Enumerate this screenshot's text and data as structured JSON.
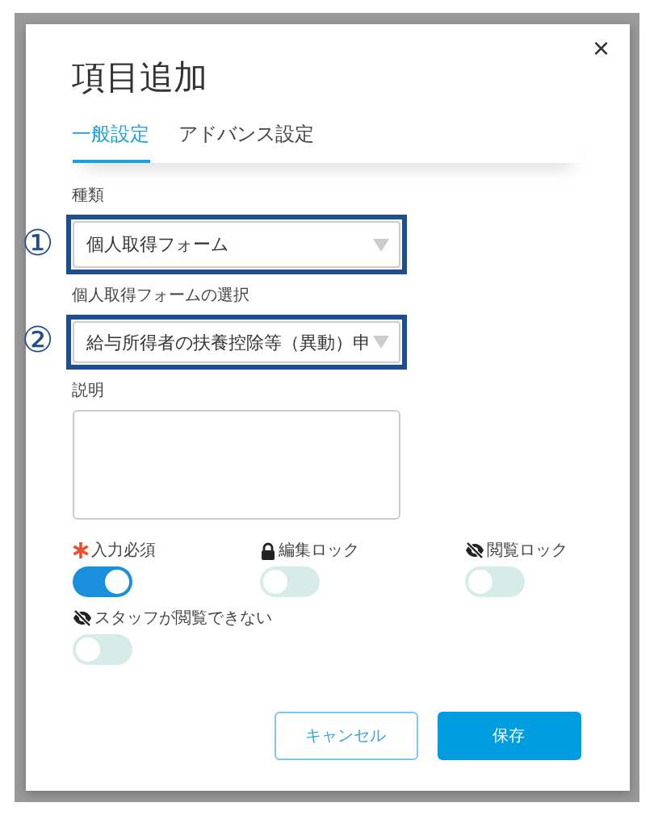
{
  "dialog": {
    "title": "項目追加",
    "close": "×"
  },
  "tabs": [
    {
      "label": "一般設定",
      "selected": true
    },
    {
      "label": "アドバンス設定",
      "selected": false
    }
  ],
  "fields": [
    {
      "kind": "select",
      "label": "種類",
      "value": "個人取得フォーム",
      "callout": "①"
    },
    {
      "kind": "select",
      "label": "個人取得フォームの選択",
      "value": "給与所得者の扶養控除等（異動）申",
      "callout": "②"
    },
    {
      "kind": "textarea",
      "label": "説明"
    }
  ],
  "toggles": [
    {
      "kind": "required",
      "label": "入力必須",
      "on": true
    },
    {
      "kind": "locked",
      "label": "編集ロック",
      "on": false
    },
    {
      "kind": "hidden",
      "label": "閲覧ロック",
      "on": false
    },
    {
      "kind": "hidden",
      "label": "スタッフが閲覧できない",
      "on": false
    }
  ],
  "buttons": [
    {
      "kind": "secondary",
      "label": "キャンセル"
    },
    {
      "kind": "primary",
      "label": "保存"
    }
  ]
}
